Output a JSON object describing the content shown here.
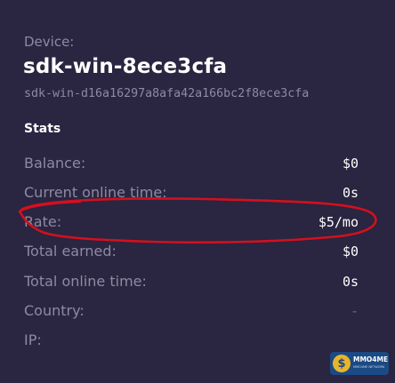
{
  "device": {
    "label": "Device:",
    "name": "sdk-win-8ece3cfa",
    "id": "sdk-win-d16a16297a8afa42a166bc2f8ece3cfa"
  },
  "stats": {
    "title": "Stats",
    "rows": [
      {
        "label": "Balance:",
        "value": "$0"
      },
      {
        "label": "Current online time:",
        "value": "0s"
      },
      {
        "label": "Rate:",
        "value": "$5/mo"
      },
      {
        "label": "Total earned:",
        "value": "$0"
      },
      {
        "label": "Total online time:",
        "value": "0s"
      },
      {
        "label": "Country:",
        "value": "-"
      },
      {
        "label": "IP:",
        "value": ""
      }
    ]
  },
  "watermark": {
    "brand": "MMO4ME",
    "tagline": "MMO4ME NETWORK"
  },
  "colors": {
    "background": "#2a2540",
    "muted_text": "#8f8aa3",
    "annotation": "#d4101e"
  }
}
